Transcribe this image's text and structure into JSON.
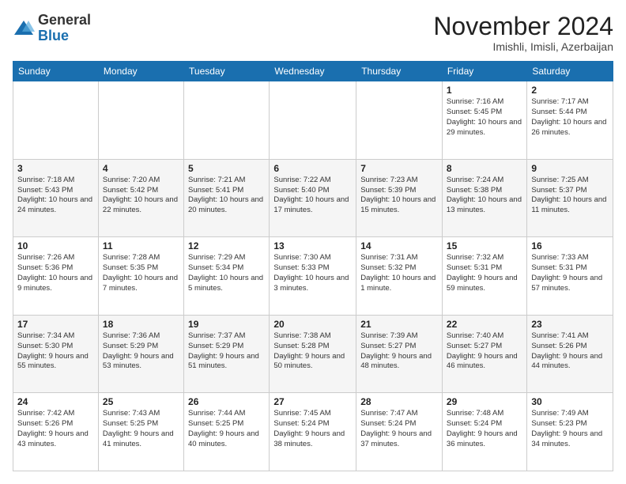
{
  "logo": {
    "general": "General",
    "blue": "Blue"
  },
  "title": "November 2024",
  "subtitle": "Imishli, Imisli, Azerbaijan",
  "days_of_week": [
    "Sunday",
    "Monday",
    "Tuesday",
    "Wednesday",
    "Thursday",
    "Friday",
    "Saturday"
  ],
  "weeks": [
    [
      {
        "day": "",
        "info": ""
      },
      {
        "day": "",
        "info": ""
      },
      {
        "day": "",
        "info": ""
      },
      {
        "day": "",
        "info": ""
      },
      {
        "day": "",
        "info": ""
      },
      {
        "day": "1",
        "info": "Sunrise: 7:16 AM\nSunset: 5:45 PM\nDaylight: 10 hours and 29 minutes."
      },
      {
        "day": "2",
        "info": "Sunrise: 7:17 AM\nSunset: 5:44 PM\nDaylight: 10 hours and 26 minutes."
      }
    ],
    [
      {
        "day": "3",
        "info": "Sunrise: 7:18 AM\nSunset: 5:43 PM\nDaylight: 10 hours and 24 minutes."
      },
      {
        "day": "4",
        "info": "Sunrise: 7:20 AM\nSunset: 5:42 PM\nDaylight: 10 hours and 22 minutes."
      },
      {
        "day": "5",
        "info": "Sunrise: 7:21 AM\nSunset: 5:41 PM\nDaylight: 10 hours and 20 minutes."
      },
      {
        "day": "6",
        "info": "Sunrise: 7:22 AM\nSunset: 5:40 PM\nDaylight: 10 hours and 17 minutes."
      },
      {
        "day": "7",
        "info": "Sunrise: 7:23 AM\nSunset: 5:39 PM\nDaylight: 10 hours and 15 minutes."
      },
      {
        "day": "8",
        "info": "Sunrise: 7:24 AM\nSunset: 5:38 PM\nDaylight: 10 hours and 13 minutes."
      },
      {
        "day": "9",
        "info": "Sunrise: 7:25 AM\nSunset: 5:37 PM\nDaylight: 10 hours and 11 minutes."
      }
    ],
    [
      {
        "day": "10",
        "info": "Sunrise: 7:26 AM\nSunset: 5:36 PM\nDaylight: 10 hours and 9 minutes."
      },
      {
        "day": "11",
        "info": "Sunrise: 7:28 AM\nSunset: 5:35 PM\nDaylight: 10 hours and 7 minutes."
      },
      {
        "day": "12",
        "info": "Sunrise: 7:29 AM\nSunset: 5:34 PM\nDaylight: 10 hours and 5 minutes."
      },
      {
        "day": "13",
        "info": "Sunrise: 7:30 AM\nSunset: 5:33 PM\nDaylight: 10 hours and 3 minutes."
      },
      {
        "day": "14",
        "info": "Sunrise: 7:31 AM\nSunset: 5:32 PM\nDaylight: 10 hours and 1 minute."
      },
      {
        "day": "15",
        "info": "Sunrise: 7:32 AM\nSunset: 5:31 PM\nDaylight: 9 hours and 59 minutes."
      },
      {
        "day": "16",
        "info": "Sunrise: 7:33 AM\nSunset: 5:31 PM\nDaylight: 9 hours and 57 minutes."
      }
    ],
    [
      {
        "day": "17",
        "info": "Sunrise: 7:34 AM\nSunset: 5:30 PM\nDaylight: 9 hours and 55 minutes."
      },
      {
        "day": "18",
        "info": "Sunrise: 7:36 AM\nSunset: 5:29 PM\nDaylight: 9 hours and 53 minutes."
      },
      {
        "day": "19",
        "info": "Sunrise: 7:37 AM\nSunset: 5:29 PM\nDaylight: 9 hours and 51 minutes."
      },
      {
        "day": "20",
        "info": "Sunrise: 7:38 AM\nSunset: 5:28 PM\nDaylight: 9 hours and 50 minutes."
      },
      {
        "day": "21",
        "info": "Sunrise: 7:39 AM\nSunset: 5:27 PM\nDaylight: 9 hours and 48 minutes."
      },
      {
        "day": "22",
        "info": "Sunrise: 7:40 AM\nSunset: 5:27 PM\nDaylight: 9 hours and 46 minutes."
      },
      {
        "day": "23",
        "info": "Sunrise: 7:41 AM\nSunset: 5:26 PM\nDaylight: 9 hours and 44 minutes."
      }
    ],
    [
      {
        "day": "24",
        "info": "Sunrise: 7:42 AM\nSunset: 5:26 PM\nDaylight: 9 hours and 43 minutes."
      },
      {
        "day": "25",
        "info": "Sunrise: 7:43 AM\nSunset: 5:25 PM\nDaylight: 9 hours and 41 minutes."
      },
      {
        "day": "26",
        "info": "Sunrise: 7:44 AM\nSunset: 5:25 PM\nDaylight: 9 hours and 40 minutes."
      },
      {
        "day": "27",
        "info": "Sunrise: 7:45 AM\nSunset: 5:24 PM\nDaylight: 9 hours and 38 minutes."
      },
      {
        "day": "28",
        "info": "Sunrise: 7:47 AM\nSunset: 5:24 PM\nDaylight: 9 hours and 37 minutes."
      },
      {
        "day": "29",
        "info": "Sunrise: 7:48 AM\nSunset: 5:24 PM\nDaylight: 9 hours and 36 minutes."
      },
      {
        "day": "30",
        "info": "Sunrise: 7:49 AM\nSunset: 5:23 PM\nDaylight: 9 hours and 34 minutes."
      }
    ]
  ]
}
